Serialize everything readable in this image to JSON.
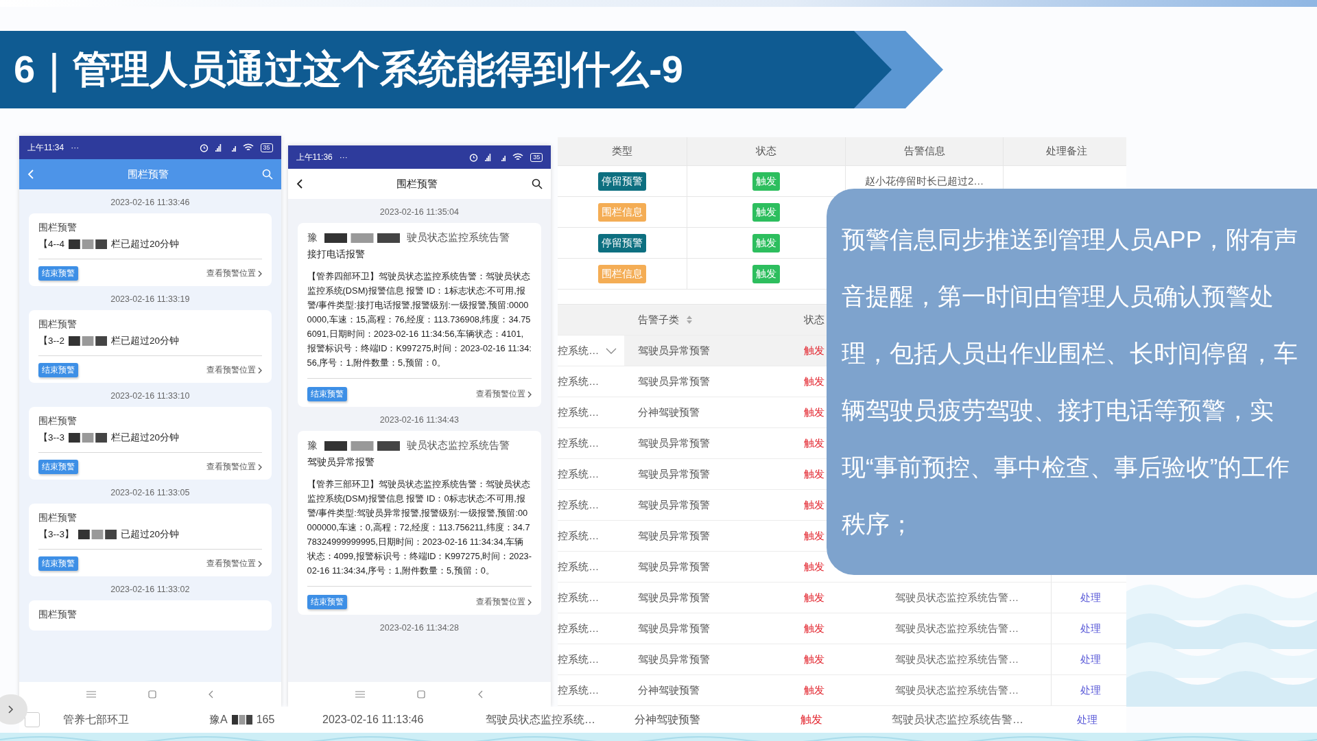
{
  "title": "6｜管理人员通过这个系统能得到什么-9",
  "phone_left": {
    "status_time": "上午11:34",
    "status_dots": "···",
    "battery": "35",
    "header_title": "围栏预警",
    "groups": [
      {
        "time": "2023-02-16 11:33:46",
        "title": "围栏预警",
        "line_start": "【4--4",
        "line_end": "栏已超过20分钟",
        "button": "结束预警",
        "link": "查看预警位置"
      },
      {
        "time": "2023-02-16 11:33:19",
        "title": "围栏预警",
        "line_start": "【3--2",
        "line_end": "栏已超过20分钟",
        "button": "结束预警",
        "link": "查看预警位置"
      },
      {
        "time": "2023-02-16 11:33:10",
        "title": "围栏预警",
        "line_start": "【3--3",
        "line_end": "栏已超过20分钟",
        "button": "结束预警",
        "link": "查看预警位置"
      },
      {
        "time": "2023-02-16 11:33:05",
        "title": "围栏预警",
        "line_start": "【3--3】",
        "line_end": "已超过20分钟",
        "button": "结束预警",
        "link": "查看预警位置"
      },
      {
        "time": "2023-02-16 11:33:02",
        "title": "围栏预警"
      }
    ]
  },
  "phone_middle": {
    "status_time": "上午11:36",
    "status_dots": "···",
    "battery": "35",
    "header_title": "围栏预警",
    "groups": [
      {
        "time": "2023-02-16 11:35:04",
        "title_start": "豫",
        "title_end": "驶员状态监控系统告警",
        "subtitle": "接打电话报警",
        "body": "【管养四部环卫】驾驶员状态监控系统告警：驾驶员状态监控系统(DSM)报警信息 报警 ID：1标志状态:不可用,报警/事件类型:接打电话报警,报警级别:一级报警,预留:00000000,车速：15,高程：76,经度：113.736908,纬度：34.756091,日期时间：2023-02-16 11:34:56,车辆状态：4101,报警标识号：终端ID：K997275,时间：2023-02-16 11:34:56,序号：1,附件数量：5,预留：0。",
        "button": "结束预警",
        "link": "查看预警位置"
      },
      {
        "time": "2023-02-16 11:34:43",
        "title_start": "豫",
        "title_end": "驶员状态监控系统告警",
        "subtitle": "驾驶员异常报警",
        "body": "【管养三部环卫】驾驶员状态监控系统告警：驾驶员状态监控系统(DSM)报警信息 报警 ID：0标志状态:不可用,报警/事件类型:驾驶员异常报警,报警级别:一级报警,预留:00000000,车速：0,高程：72,经度：113.756211,纬度：34.778324999999995,日期时间：2023-02-16 11:34:34,车辆状态：4099,报警标识号：终端ID：K997275,时间：2023-02-16 11:34:34,序号：1,附件数量：5,预留：0。",
        "button": "结束预警",
        "link": "查看预警位置"
      },
      {
        "time": "2023-02-16 11:34:28"
      }
    ]
  },
  "type_table": {
    "columns": [
      "类型",
      "状态",
      "告警信息",
      "处理备注"
    ],
    "rows": [
      {
        "type": "停留预警",
        "kind": "stay",
        "status": "触发",
        "info": "赵小花停留时长已超过2…"
      },
      {
        "type": "围栏信息",
        "kind": "fence",
        "status": "触发"
      },
      {
        "type": "停留预警",
        "kind": "stay",
        "status": "触发"
      },
      {
        "type": "围栏信息",
        "kind": "fence",
        "status": "触发"
      }
    ]
  },
  "alarm_table": {
    "columns": [
      "告警子类",
      "状态"
    ],
    "rows": [
      {
        "system": "控系统…",
        "subtype": "驾驶员异常预警",
        "status": "触发",
        "highlighted": true
      },
      {
        "system": "控系统…",
        "subtype": "驾驶员异常预警",
        "status": "触发",
        "highlighted": false
      },
      {
        "system": "控系统…",
        "subtype": "分神驾驶预警",
        "status": "触发",
        "highlighted": false
      },
      {
        "system": "控系统…",
        "subtype": "驾驶员异常预警",
        "status": "触发",
        "highlighted": false
      },
      {
        "system": "控系统…",
        "subtype": "驾驶员异常预警",
        "status": "触发",
        "highlighted": false
      },
      {
        "system": "控系统…",
        "subtype": "驾驶员异常预警",
        "status": "触发",
        "highlighted": false
      },
      {
        "system": "控系统…",
        "subtype": "驾驶员异常预警",
        "status": "触发",
        "highlighted": false
      },
      {
        "system": "控系统…",
        "subtype": "驾驶员异常预警",
        "status": "触发",
        "highlighted": false
      },
      {
        "system": "控系统…",
        "subtype": "驾驶员异常预警",
        "status": "触发",
        "info": "驾驶员状态监控系统告警…",
        "action": "处理",
        "highlighted": false
      },
      {
        "system": "控系统…",
        "subtype": "驾驶员异常预警",
        "status": "触发",
        "info": "驾驶员状态监控系统告警…",
        "action": "处理",
        "highlighted": false
      },
      {
        "system": "控系统…",
        "subtype": "驾驶员异常预警",
        "status": "触发",
        "info": "驾驶员状态监控系统告警…",
        "action": "处理",
        "highlighted": false
      },
      {
        "system": "控系统…",
        "subtype": "分神驾驶预警",
        "status": "触发",
        "info": "驾驶员状态监控系统告警…",
        "action": "处理",
        "highlighted": false
      }
    ]
  },
  "bottom_row": {
    "checked": false,
    "org": "管养七部环卫",
    "plate_start": "豫A",
    "plate_end": "165",
    "time": "2023-02-16 11:13:46",
    "system": "驾驶员状态监控系统…",
    "subtype": "分神驾驶预警",
    "status": "触发",
    "info": "驾驶员状态监控系统告警…",
    "action": "处理"
  },
  "overlay_text": "预警信息同步推送到管理人员APP，附有声音提醒，第一时间由管理人员确认预警处理，包括人员出作业围栏、长时间停留，车辆驾驶员疲劳驾驶、接打电话等预警，实现“事前预控、事中检查、事后验收”的工作秩序；"
}
